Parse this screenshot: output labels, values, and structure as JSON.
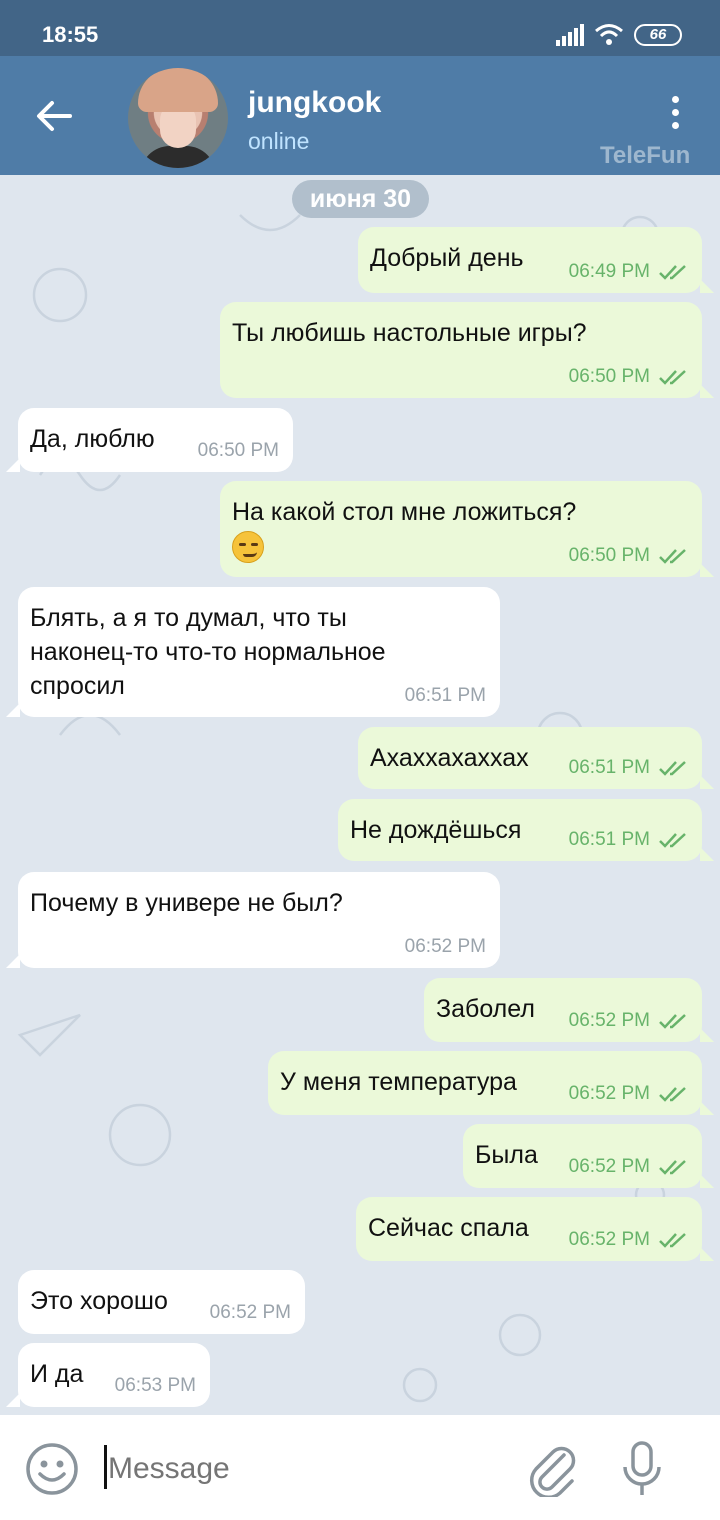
{
  "statusbar": {
    "time": "18:55",
    "battery": "66"
  },
  "header": {
    "name": "jungkook",
    "status": "online",
    "watermark": "TeleFun"
  },
  "date_label": "июня 30",
  "messages": [
    {
      "dir": "out",
      "text": "Добрый день",
      "time": "06:49 PM"
    },
    {
      "dir": "out",
      "text": "Ты любишь настольные игры?",
      "time": "06:50 PM"
    },
    {
      "dir": "in",
      "text": "Да, люблю",
      "time": "06:50 PM"
    },
    {
      "dir": "out",
      "text": "На какой стол мне ложиться?",
      "time": "06:50 PM",
      "emoji": "smirk"
    },
    {
      "dir": "in",
      "lines": [
        "Блять, а я то думал, что ты",
        "наконец-то что-то нормальное",
        "спросил"
      ],
      "time": "06:51 PM"
    },
    {
      "dir": "out",
      "text": "Ахаххахаххах",
      "time": "06:51 PM"
    },
    {
      "dir": "out",
      "text": "Не дождёшься",
      "time": "06:51 PM"
    },
    {
      "dir": "in",
      "text": "Почему в универе не был?",
      "time": "06:52 PM"
    },
    {
      "dir": "out",
      "text": "Заболел",
      "time": "06:52 PM"
    },
    {
      "dir": "out",
      "text": "У меня температура",
      "time": "06:52 PM"
    },
    {
      "dir": "out",
      "text": "Была",
      "time": "06:52 PM"
    },
    {
      "dir": "out",
      "text": "Сейчас спала",
      "time": "06:52 PM"
    },
    {
      "dir": "in",
      "text": "Это хорошо",
      "time": "06:52 PM"
    },
    {
      "dir": "in",
      "text": "И да",
      "time": "06:53 PM"
    }
  ],
  "composer": {
    "placeholder": "Message"
  },
  "colors": {
    "header": "#4f7ca7",
    "statusbar": "#426587",
    "outgoing": "#ebf9d9",
    "incoming": "#ffffff",
    "tick": "#67b36a"
  }
}
